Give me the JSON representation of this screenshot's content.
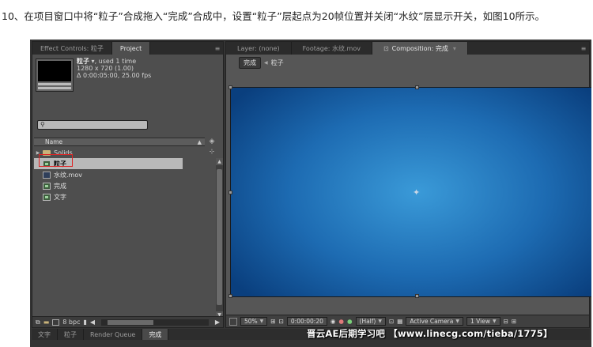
{
  "caption": "10、在项目窗口中将“粒子”合成拖入“完成”合成中，设置“粒子”层起点为20帧位置并关闭“水纹”层显示开关，如图10所示。",
  "project_panel": {
    "tabs": [
      {
        "label": "Effect Controls: 粒子",
        "active": false
      },
      {
        "label": "Project",
        "active": true
      }
    ],
    "selected_item": {
      "name": "粒子",
      "usage": ", used 1 time",
      "dimensions": "1280 x 720 (1.00)",
      "duration": "Δ 0:00:05:00, 25.00 fps"
    },
    "search": {
      "placeholder": ""
    },
    "column_header": "Name",
    "items": [
      {
        "name": "Solids",
        "type": "folder",
        "selected": false
      },
      {
        "name": "粒子",
        "type": "composition",
        "selected": true
      },
      {
        "name": "水纹.mov",
        "type": "footage",
        "selected": false
      },
      {
        "name": "完成",
        "type": "composition",
        "selected": false
      },
      {
        "name": "文字",
        "type": "composition",
        "selected": false
      }
    ],
    "footer": {
      "bit_depth": "8 bpc"
    }
  },
  "composition_panel": {
    "tabs": [
      {
        "label": "Layer: (none)",
        "active": false
      },
      {
        "label": "Footage: 水纹.mov",
        "active": false
      },
      {
        "label": "Composition: 完成",
        "active": true
      }
    ],
    "breadcrumbs": [
      "完成",
      "粒子"
    ],
    "footer": {
      "zoom": "50%",
      "timecode": "0:00:00:20",
      "resolution": "(Half)",
      "camera": "Active Camera",
      "views": "1 View"
    }
  },
  "timeline_tabs": [
    {
      "label": "文字",
      "active": false
    },
    {
      "label": "粒子",
      "active": false
    },
    {
      "label": "Render Queue",
      "active": false
    },
    {
      "label": "完成",
      "active": true
    }
  ],
  "watermark": "晋云AE后期学习吧 【www.linecg.com/tieba/1775】",
  "colors": {
    "viewer_center": "#3a9ad8",
    "viewer_edge": "#0a3f7e",
    "selection_box": "#e02424"
  }
}
